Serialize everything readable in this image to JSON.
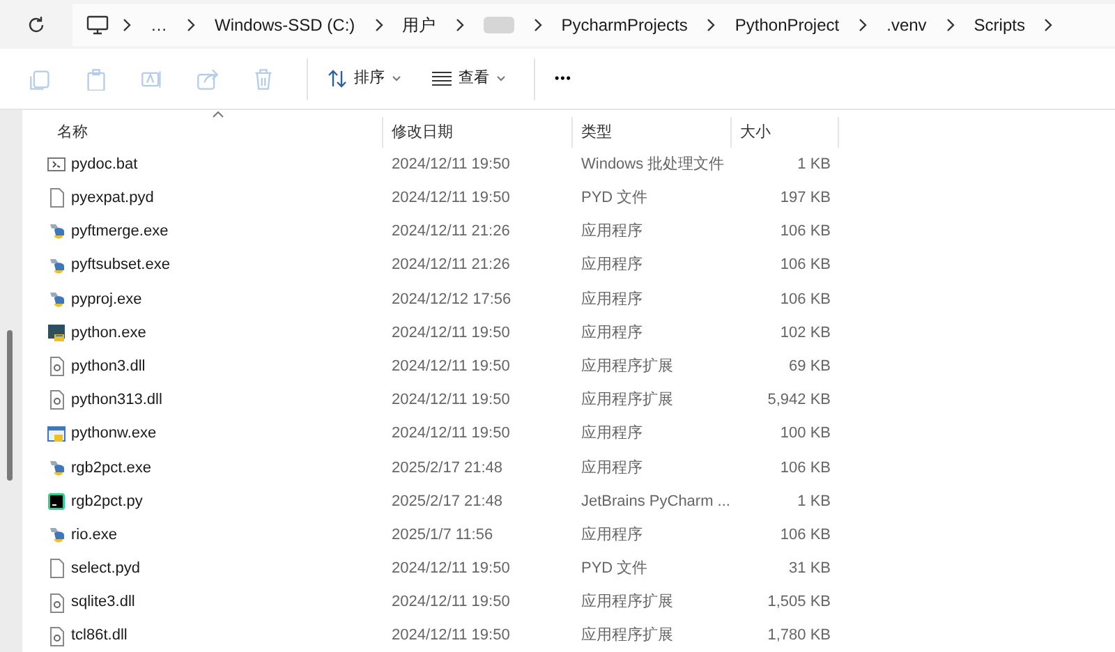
{
  "breadcrumb": {
    "items": [
      {
        "label": "…",
        "kind": "text"
      },
      {
        "label": "Windows-SSD (C:)",
        "kind": "text"
      },
      {
        "label": "用户",
        "kind": "text"
      },
      {
        "kind": "redacted"
      },
      {
        "label": "PycharmProjects",
        "kind": "text"
      },
      {
        "label": "PythonProject",
        "kind": "text"
      },
      {
        "label": ".venv",
        "kind": "text"
      },
      {
        "label": "Scripts",
        "kind": "text"
      }
    ]
  },
  "toolbar": {
    "icon_buttons": [
      {
        "kind": "copy",
        "disabled": true
      },
      {
        "kind": "paste",
        "disabled": true
      },
      {
        "kind": "rename",
        "disabled": true
      },
      {
        "kind": "share",
        "disabled": true
      },
      {
        "kind": "delete",
        "disabled": true
      }
    ],
    "sort_label": "排序",
    "view_label": "查看",
    "more_label": "•••"
  },
  "table": {
    "columns": [
      "名称",
      "修改日期",
      "类型",
      "大小"
    ],
    "rows": [
      {
        "kind": "bat",
        "name": "pydoc.bat",
        "date": "2024/12/11 19:50",
        "type": "Windows 批处理文件",
        "size": "1 KB"
      },
      {
        "kind": "file",
        "name": "pyexpat.pyd",
        "date": "2024/12/11 19:50",
        "type": "PYD 文件",
        "size": "197 KB"
      },
      {
        "kind": "pyexe",
        "name": "pyftmerge.exe",
        "date": "2024/12/11 21:26",
        "type": "应用程序",
        "size": "106 KB"
      },
      {
        "kind": "pyexe",
        "name": "pyftsubset.exe",
        "date": "2024/12/11 21:26",
        "type": "应用程序",
        "size": "106 KB"
      },
      {
        "kind": "pyexe",
        "name": "pyproj.exe",
        "date": "2024/12/12 17:56",
        "type": "应用程序",
        "size": "106 KB"
      },
      {
        "kind": "python",
        "name": "python.exe",
        "date": "2024/12/11 19:50",
        "type": "应用程序",
        "size": "102 KB"
      },
      {
        "kind": "dll",
        "name": "python3.dll",
        "date": "2024/12/11 19:50",
        "type": "应用程序扩展",
        "size": "69 KB"
      },
      {
        "kind": "dll",
        "name": "python313.dll",
        "date": "2024/12/11 19:50",
        "type": "应用程序扩展",
        "size": "5,942 KB"
      },
      {
        "kind": "pythonw",
        "name": "pythonw.exe",
        "date": "2024/12/11 19:50",
        "type": "应用程序",
        "size": "100 KB"
      },
      {
        "kind": "pyexe",
        "name": "rgb2pct.exe",
        "date": "2025/2/17 21:48",
        "type": "应用程序",
        "size": "106 KB"
      },
      {
        "kind": "pycharm",
        "name": "rgb2pct.py",
        "date": "2025/2/17 21:48",
        "type": "JetBrains PyCharm ...",
        "size": "1 KB"
      },
      {
        "kind": "pyexe",
        "name": "rio.exe",
        "date": "2025/1/7 11:56",
        "type": "应用程序",
        "size": "106 KB"
      },
      {
        "kind": "file",
        "name": "select.pyd",
        "date": "2024/12/11 19:50",
        "type": "PYD 文件",
        "size": "31 KB"
      },
      {
        "kind": "dll",
        "name": "sqlite3.dll",
        "date": "2024/12/11 19:50",
        "type": "应用程序扩展",
        "size": "1,505 KB"
      },
      {
        "kind": "dll",
        "name": "tcl86t.dll",
        "date": "2024/12/11 19:50",
        "type": "应用程序扩展",
        "size": "1,780 KB"
      }
    ]
  }
}
